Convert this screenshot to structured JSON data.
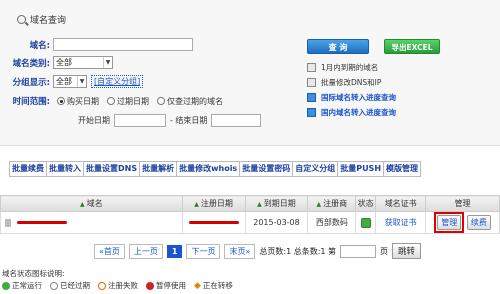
{
  "panel": {
    "title": "域名查询",
    "domain_label": "域名:",
    "category_label": "域名类别:",
    "category_value": "全部",
    "group_label": "分组显示:",
    "group_value": "全部",
    "custom_group_link": "[自定义分组]",
    "time_label": "时间范围:",
    "radio_options": [
      "购买日期",
      "过期日期",
      "仅查过期的域名"
    ],
    "start_date_label": "开始日期",
    "end_date_label": "- 结束日期",
    "query_button": "查 询",
    "excel_button": "导出EXCEL",
    "side_items": [
      {
        "label": "1月内到期的域名",
        "link": false
      },
      {
        "label": "批量修改DNS和IP",
        "link": false
      },
      {
        "label": "国际域名转入进度查询",
        "link": true
      },
      {
        "label": "国内域名转入进度查询",
        "link": true
      }
    ]
  },
  "toolbar": [
    "批量续费",
    "批量转入",
    "批量设置DNS",
    "批量解析",
    "批量修改whois",
    "批量设置密码",
    "自定义分组",
    "批量PUSH",
    "模版管理"
  ],
  "table": {
    "headers": [
      "域名",
      "注册日期",
      "到期日期",
      "注册商",
      "状态",
      "域名证书",
      "管理"
    ],
    "rows": [
      {
        "expiry": "2015-03-08",
        "registrar": "西部数码",
        "cert": "获取证书",
        "manage": "管理",
        "renew": "续费"
      }
    ]
  },
  "pager": {
    "first": "«首页",
    "prev": "上一页",
    "current": "1",
    "next": "下一页",
    "last": "末页»",
    "summary": "总页数:1 总条数:1 第",
    "page_suffix": "页",
    "go": "跳转"
  },
  "legend": {
    "title": "域名状态图标说明:",
    "items": [
      {
        "label": "正常运行",
        "color": "#3fae3f"
      },
      {
        "label": "已经过期",
        "color": "#888888"
      },
      {
        "label": "注册失败",
        "color": "#e06a00"
      },
      {
        "label": "暂停使用",
        "color": "#cc2222"
      },
      {
        "label": "正在转移",
        "color": "#e08a00"
      }
    ]
  }
}
